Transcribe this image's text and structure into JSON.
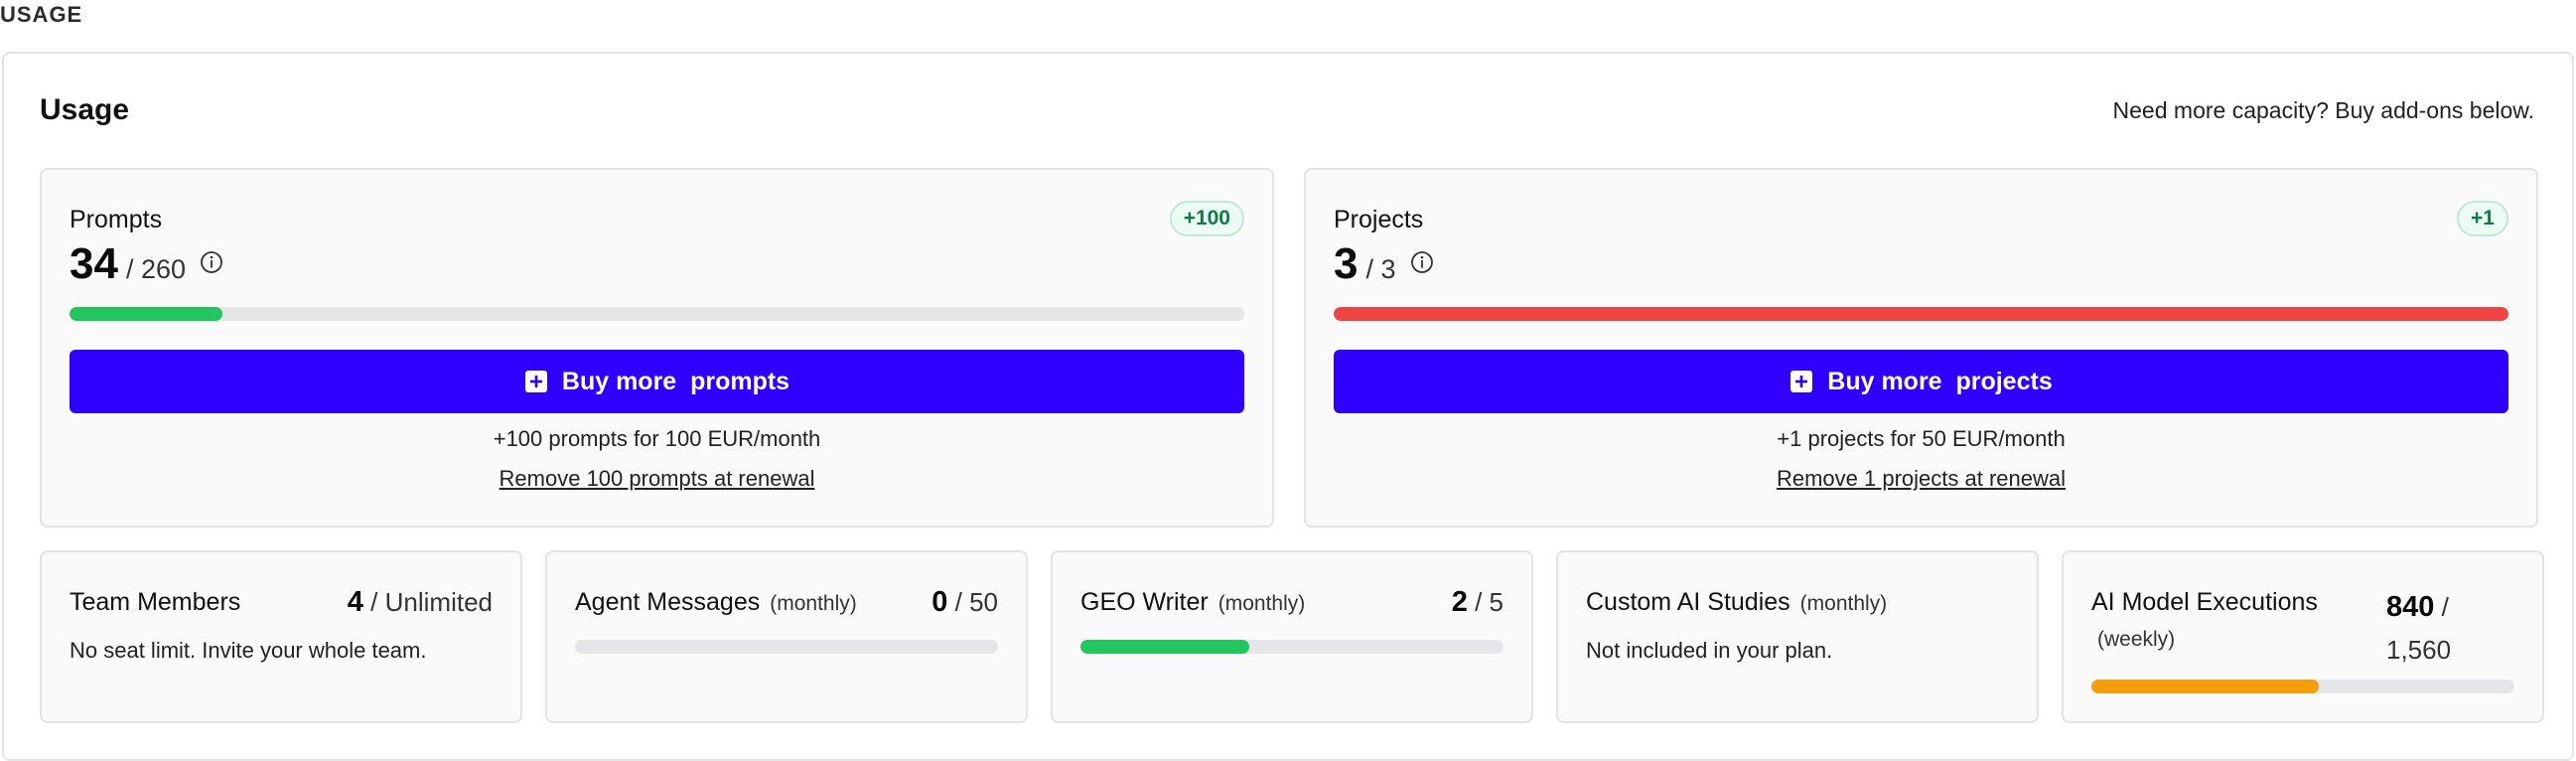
{
  "section_label": "USAGE",
  "header": {
    "title": "Usage",
    "hint": "Need more capacity? Buy add-ons below."
  },
  "prompts": {
    "label": "Prompts",
    "badge": "+100",
    "used": "34",
    "limit_text": "/ 260",
    "progress": 0.13,
    "progress_color": "#22c55e",
    "buy_label": "Buy more  prompts",
    "price_text": "+100 prompts for 100 EUR/month",
    "remove_text": "Remove 100 prompts at renewal"
  },
  "projects": {
    "label": "Projects",
    "badge": "+1",
    "used": "3",
    "limit_text": "/ 3",
    "progress": 1.0,
    "progress_color": "#ef4444",
    "buy_label": "Buy more  projects",
    "price_text": "+1 projects for 50 EUR/month",
    "remove_text": "Remove 1 projects at renewal"
  },
  "team_members": {
    "label": "Team Members",
    "used": "4",
    "limit_text": "/ Unlimited",
    "note": "No seat limit. Invite your whole team."
  },
  "agent_messages": {
    "label": "Agent Messages",
    "period": "(monthly)",
    "used": "0",
    "limit_text": "/ 50",
    "progress": 0.0,
    "progress_color": "#22c55e"
  },
  "geo_writer": {
    "label": "GEO Writer",
    "period": "(monthly)",
    "used": "2",
    "limit_text": "/ 5",
    "progress": 0.4,
    "progress_color": "#22c55e"
  },
  "custom_ai_studies": {
    "label": "Custom AI Studies",
    "period": "(monthly)",
    "note": "Not included in your plan."
  },
  "ai_model_executions": {
    "label": "AI Model Executions",
    "period": "(weekly)",
    "used": "840",
    "slash": "/",
    "limit": "1,560",
    "progress": 0.5385,
    "progress_color": "#f59e0b"
  },
  "colors": {
    "accent": "#2f00ff",
    "badge_text": "#0e7a4a",
    "track": "#e5e6ea"
  },
  "icons": {
    "info": "info-circle-icon",
    "plus": "plus-square-icon"
  }
}
